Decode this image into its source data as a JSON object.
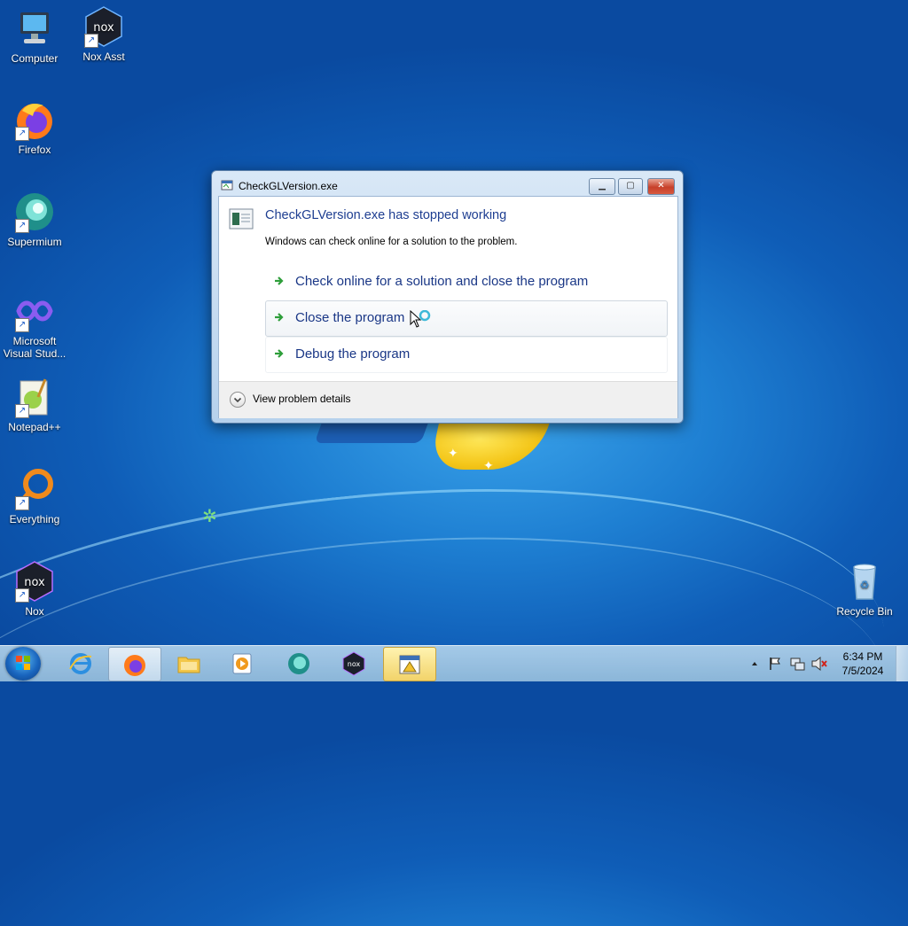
{
  "desktop": {
    "icons": [
      {
        "label": "Computer"
      },
      {
        "label": "Nox Asst"
      },
      {
        "label": "Firefox"
      },
      {
        "label": "Supermium"
      },
      {
        "label": "Microsoft Visual Stud..."
      },
      {
        "label": "Notepad++"
      },
      {
        "label": "Everything"
      },
      {
        "label": "Nox"
      },
      {
        "label": "Recycle Bin"
      }
    ]
  },
  "dialog": {
    "title": "CheckGLVersion.exe",
    "headline": "CheckGLVersion.exe has stopped working",
    "subtext": "Windows can check online for a solution to the problem.",
    "options": [
      {
        "label": "Check online for a solution and close the program"
      },
      {
        "label": "Close the program"
      },
      {
        "label": "Debug the program"
      }
    ],
    "details_label": "View problem details",
    "colors": {
      "headline": "#1e3e91",
      "option": "#1a3786",
      "arrow": "#2e9e3a",
      "close": "#c7402a"
    }
  },
  "taskbar": {
    "clock_time": "6:34 PM",
    "clock_date": "7/5/2024",
    "pinned": [
      "internet-explorer-icon",
      "firefox-icon",
      "explorer-folder-icon",
      "media-player-icon",
      "supermium-icon",
      "nox-icon",
      "error-report-icon"
    ]
  }
}
